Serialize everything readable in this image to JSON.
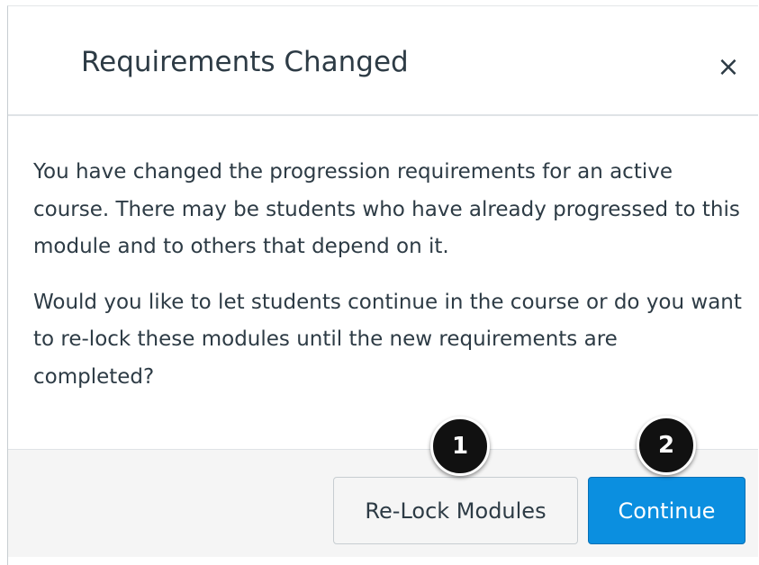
{
  "dialog": {
    "title": "Requirements Changed",
    "close_label": "×",
    "body": [
      "You have changed the progression requirements for an active course. There may be students who have already progressed to this module and to others that depend on it.",
      "Would you like to let students continue in the course or do you want to re-lock these modules until the new requirements are completed?"
    ],
    "buttons": {
      "relock_label": "Re-Lock Modules",
      "continue_label": "Continue"
    }
  },
  "callouts": [
    "1",
    "2"
  ],
  "colors": {
    "primary": "#0b8fe0",
    "text": "#2d3b45",
    "footer_bg": "#f5f5f5",
    "callout_bg": "#111111"
  },
  "icons": {
    "close": "close-icon"
  }
}
